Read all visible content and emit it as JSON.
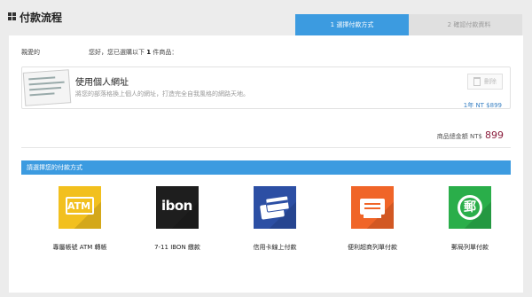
{
  "header": {
    "title": "付款流程",
    "steps": [
      {
        "label": "1 選擇付款方式"
      },
      {
        "label": "2 確認付款資料"
      }
    ]
  },
  "greeting": {
    "name": "親愛的",
    "message_prefix": "您好，您已選購以下",
    "count": "1",
    "message_suffix": "件商品："
  },
  "item": {
    "name": "使用個人網址",
    "description": "將您的部落格換上個人的網址，打造完全自我風格的網路天地。",
    "remove_label": "刪除",
    "price_line": "1年 NT $899"
  },
  "total": {
    "label": "商品總金額 NT$",
    "amount": "899"
  },
  "section": {
    "title": "請選擇您的付款方式"
  },
  "methods": [
    {
      "icon_text": "ATM",
      "label": "專屬帳號 ATM 轉帳"
    },
    {
      "icon_text": "ibon",
      "label": "7-11 IBON 繳款"
    },
    {
      "icon_text": "",
      "label": "信用卡線上付款"
    },
    {
      "icon_text": "",
      "label": "便利超商列單付款"
    },
    {
      "icon_text": "郵",
      "label": "郵局列單付款"
    }
  ],
  "colors": {
    "accent": "#3c9be0",
    "atm": "#f2c01e",
    "ibon": "#1e1e1e",
    "card": "#2c4fa4",
    "convenience": "#f06528",
    "post": "#2aae4a",
    "total_amount": "#8b1d3c"
  }
}
